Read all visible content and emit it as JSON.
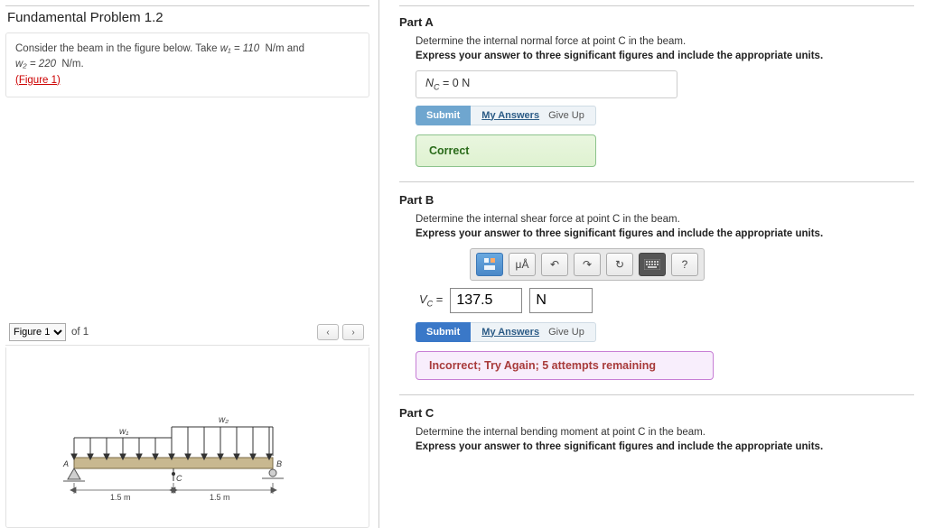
{
  "problem": {
    "title": "Fundamental Problem 1.2",
    "text_pre": "Consider the beam in the figure below. Take ",
    "w1": "w₁ = 110",
    "w1_units": "N/m",
    "text_and": " and ",
    "w2": "w₂ = 220",
    "w2_units": "N/m",
    "period": ".",
    "figure_link": "(Figure 1)"
  },
  "figure": {
    "select_label": "Figure 1",
    "of": "of 1",
    "labels": {
      "w1": "w₁",
      "w2": "w₂",
      "A": "A",
      "B": "B",
      "C": "C",
      "len1": "1.5 m",
      "len2": "1.5 m"
    }
  },
  "partA": {
    "label": "Part A",
    "prompt": "Determine the internal normal force at point C in the beam.",
    "instr": "Express your answer to three significant figures and include the appropriate units.",
    "answer_var": "N",
    "answer_sub": "C",
    "answer_eq": " = ",
    "answer_val": "0 N",
    "submit": "Submit",
    "my_answers": "My Answers",
    "give_up": "Give Up",
    "feedback": "Correct"
  },
  "partB": {
    "label": "Part B",
    "prompt": "Determine the internal shear force at point C in the beam.",
    "instr": "Express your answer to three significant figures and include the appropriate units.",
    "tools": {
      "units_accent": "μÅ",
      "help": "?"
    },
    "answer_var": "V",
    "answer_sub": "C",
    "answer_eq": " = ",
    "value": "137.5",
    "unit": "N",
    "submit": "Submit",
    "my_answers": "My Answers",
    "give_up": "Give Up",
    "feedback": "Incorrect; Try Again; 5 attempts remaining"
  },
  "partC": {
    "label": "Part C",
    "prompt": "Determine the internal bending moment at point C in the beam.",
    "instr": "Express your answer to three significant figures and include the appropriate units."
  }
}
